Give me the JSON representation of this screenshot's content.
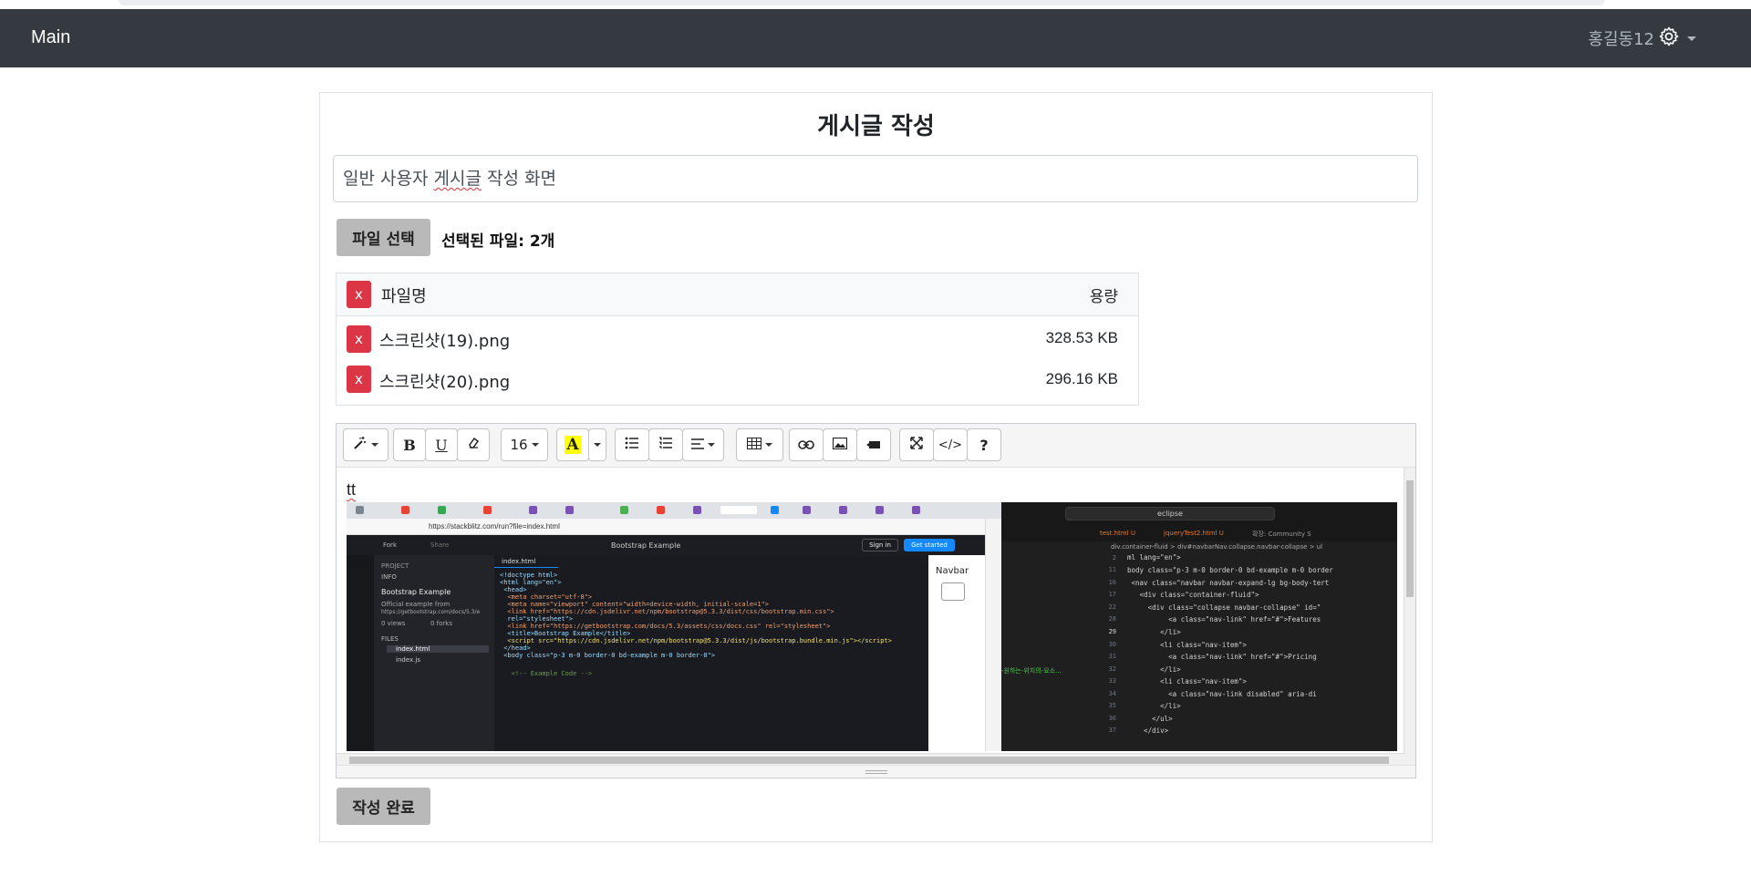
{
  "navbar": {
    "brand": "Main",
    "user_name": "홍길동12",
    "user_icon": "gear-icon"
  },
  "page": {
    "title": "게시글 작성"
  },
  "post_title": {
    "value_prefix": "일반 사용자 ",
    "value_misspelled": "게시글",
    "value_suffix": " 작성 화면"
  },
  "files": {
    "choose_label": "파일 선택",
    "count_label": "선택된 파일: 2개",
    "header_name": "파일명",
    "header_size": "용량",
    "remove_label": "x",
    "rows": [
      {
        "name": "스크린샷(19).png",
        "size": "328.53 KB"
      },
      {
        "name": "스크린샷(20).png",
        "size": "296.16 KB"
      }
    ]
  },
  "editor": {
    "toolbar": {
      "style": "style-magic-icon",
      "bold": "B",
      "underline": "U",
      "eraser": "eraser-icon",
      "font_size": "16",
      "color": "A",
      "ul": "unordered-list-icon",
      "ol": "ordered-list-icon",
      "align": "align-icon",
      "table": "table-icon",
      "link": "link-icon",
      "picture": "image-icon",
      "video": "video-icon",
      "fullscreen": "fullscreen-icon",
      "codeview": "</>",
      "help": "?"
    },
    "content_text": "tt",
    "embedded_image": {
      "url": "https://stackblitz.com/run?file=index.html",
      "page_title": "Bootstrap Example",
      "sign_in": "Sign in",
      "get_started": "Get started",
      "fork": "Fork",
      "share": "Share",
      "project": "PROJECT",
      "info": "INFO",
      "project_name": "Bootstrap Example",
      "project_desc": "Official example from",
      "project_link": "https://getbootstrap.com/docs/5.3/e",
      "views": "0 views",
      "forks": "0 forks",
      "files_label": "FILES",
      "file1": "index.html",
      "file2": "index.js",
      "code_tab": "index.html",
      "preview_navbar": "Navbar",
      "vs_search": "eclipse",
      "vs_tab1": "test.html U",
      "vs_tab2": "jqueryTest2.html U",
      "vs_tab3": "확장: Community S",
      "vs_breadcrumb": "div.container-fluid > div#navbarNav.collapse.navbar-collapse > ul",
      "vs_green": "-원하는-위치의-요소..."
    }
  },
  "submit": {
    "label": "작성 완료"
  }
}
